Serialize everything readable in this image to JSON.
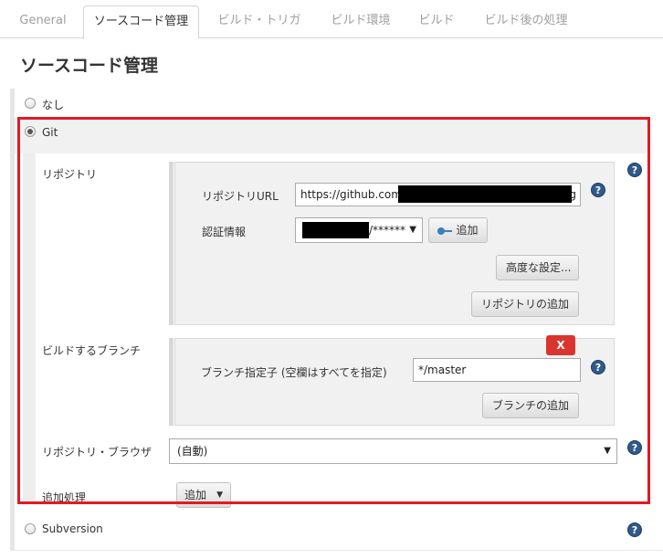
{
  "tabs": [
    "General",
    "ソースコード管理",
    "ビルド・トリガ",
    "ビルド環境",
    "ビルド",
    "ビルド後の処理"
  ],
  "page_title": "ソースコード管理",
  "scm": {
    "none_label": "なし",
    "git_label": "Git",
    "subversion_label": "Subversion"
  },
  "git": {
    "repository_section_label": "リポジトリ",
    "repository_url_label": "リポジトリURL",
    "repository_url_value_visible_start": "https://github.com/",
    "repository_url_value_visible_end": "g",
    "credentials_label": "認証情報",
    "credentials_value_visible": "/******",
    "add_credentials_label": "追加",
    "advanced_button": "高度な設定...",
    "add_repository_button": "リポジトリの追加",
    "branches_section_label": "ビルドするブランチ",
    "delete_button": "X",
    "branch_specifier_label": "ブランチ指定子 (空欄はすべてを指定)",
    "branch_specifier_value": "*/master",
    "add_branch_button": "ブランチの追加",
    "repository_browser_label": "リポジトリ・ブラウザ",
    "repository_browser_value": "(自動)",
    "additional_behaviours_label": "追加処理",
    "add_behaviour_button": "追加"
  },
  "help_icon_text": "?",
  "colors": {
    "highlight_border": "#e01b24",
    "delete_button": "#d9352f",
    "help_icon": "#2f5a8a"
  }
}
